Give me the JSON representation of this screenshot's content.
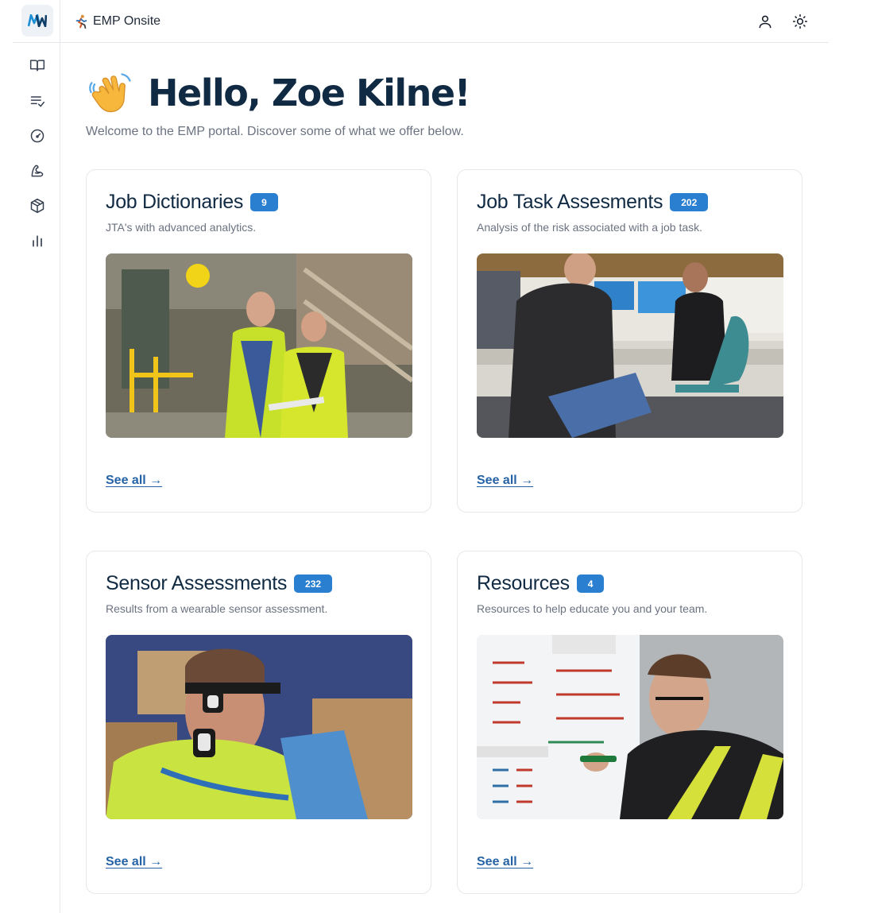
{
  "app": {
    "title": "EMP Onsite",
    "logo": "mw-logo",
    "title_icon": "running-person-icon"
  },
  "sidebar": {
    "items": [
      {
        "icon": "book-open-icon",
        "label": ""
      },
      {
        "icon": "list-check-icon",
        "label": ""
      },
      {
        "icon": "gauge-icon",
        "label": ""
      },
      {
        "icon": "bicep-icon",
        "label": ""
      },
      {
        "icon": "box-icon",
        "label": ""
      },
      {
        "icon": "bar-chart-icon",
        "label": ""
      }
    ]
  },
  "topbar": {
    "icons": [
      "user-icon",
      "sun-icon"
    ]
  },
  "hero": {
    "title": "Hello, Zoe Kilne!",
    "subtitle": "Welcome to the EMP portal. Discover some of what we offer below."
  },
  "cards": [
    {
      "title": "Job Dictionaries",
      "count": "9",
      "description": "JTA's with advanced analytics.",
      "link": "See all →"
    },
    {
      "title": "Job Task Assesments",
      "count": "202",
      "description": "Analysis of the risk associated with a job task.",
      "link": "See all →"
    },
    {
      "title": "Sensor Assessments",
      "count": "232",
      "description": "Results from a wearable sensor assessment.",
      "link": "See all →"
    },
    {
      "title": "Resources",
      "count": "4",
      "description": "Resources to help educate you and your team.",
      "link": "See all →"
    }
  ],
  "colors": {
    "accent": "#2b7fd0",
    "link": "#2563a6",
    "heading": "#102a43",
    "muted": "#6b7280",
    "border": "#e5e7eb"
  }
}
